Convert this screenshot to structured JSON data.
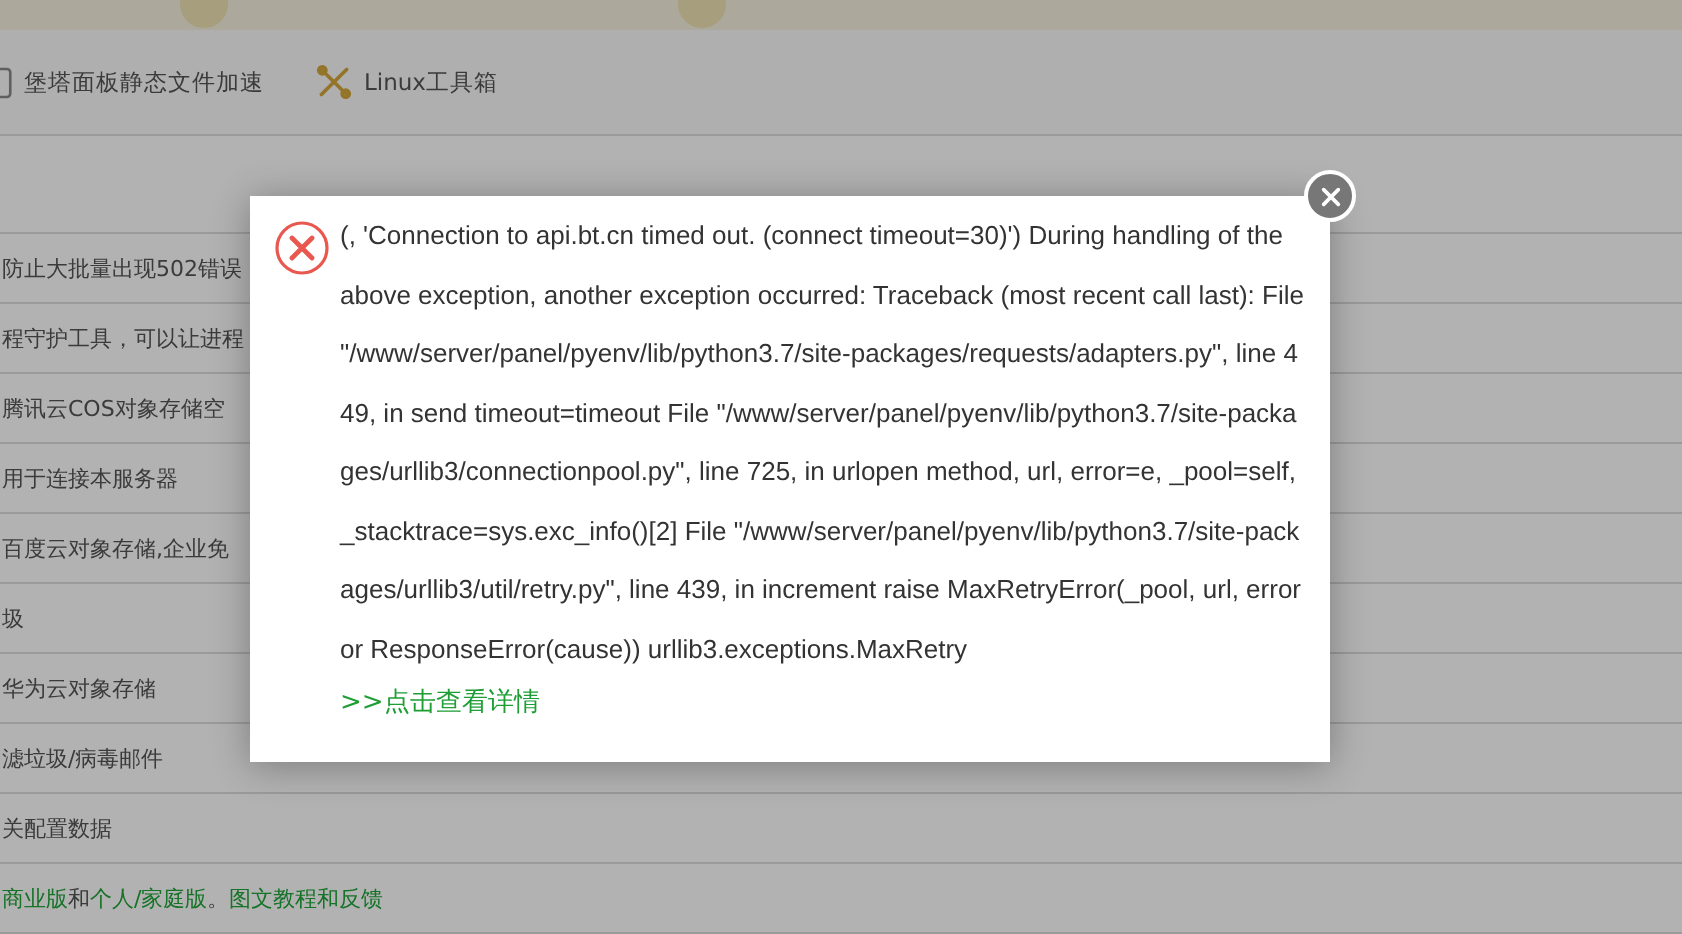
{
  "toolbar": {
    "items": [
      {
        "label": "堡塔面板静态文件加速",
        "kind": "doc"
      },
      {
        "label": "Linux工具箱",
        "kind": "tools"
      }
    ]
  },
  "list": {
    "rows": [
      {
        "segments": [
          {
            "text": "防止大批量出现502错误",
            "kind": "plain"
          }
        ]
      },
      {
        "segments": [
          {
            "text": "程守护工具，可以让进程",
            "kind": "plain"
          }
        ]
      },
      {
        "segments": [
          {
            "text": "腾讯云COS对象存储空",
            "kind": "plain"
          }
        ]
      },
      {
        "segments": [
          {
            "text": "用于连接本服务器",
            "kind": "plain"
          }
        ]
      },
      {
        "segments": [
          {
            "text": "百度云对象存储,企业免",
            "kind": "plain"
          }
        ]
      },
      {
        "segments": [
          {
            "text": "圾",
            "kind": "plain"
          }
        ]
      },
      {
        "segments": [
          {
            "text": "华为云对象存储",
            "kind": "plain"
          }
        ]
      },
      {
        "segments": [
          {
            "text": "滤垃圾/病毒邮件",
            "kind": "plain"
          }
        ]
      },
      {
        "segments": [
          {
            "text": "关配置数据",
            "kind": "plain"
          }
        ]
      },
      {
        "segments": [
          {
            "text": "商业版",
            "kind": "link"
          },
          {
            "text": "和",
            "kind": "plain"
          },
          {
            "text": "个人/家庭版",
            "kind": "link"
          },
          {
            "text": "。",
            "kind": "plain"
          },
          {
            "text": "图文教程和反馈",
            "kind": "link"
          }
        ]
      }
    ]
  },
  "dialog": {
    "message": "(, 'Connection to api.bt.cn timed out. (connect timeout=30)') During handling of the above exception, another exception occurred: Traceback (most recent call last): File \"/www/server/panel/pyenv/lib/python3.7/site-packages/requests/adapters.py\", line 449, in send timeout=timeout File \"/www/server/panel/pyenv/lib/python3.7/site-packages/urllib3/connectionpool.py\", line 725, in urlopen method, url, error=e, _pool=self, _stacktrace=sys.exc_info()[2] File \"/www/server/panel/pyenv/lib/python3.7/site-packages/urllib3/util/retry.py\", line 439, in increment raise MaxRetryError(_pool, url, error or ResponseError(cause)) urllib3.exceptions.MaxRetry",
    "link": ">>点击查看详情"
  }
}
